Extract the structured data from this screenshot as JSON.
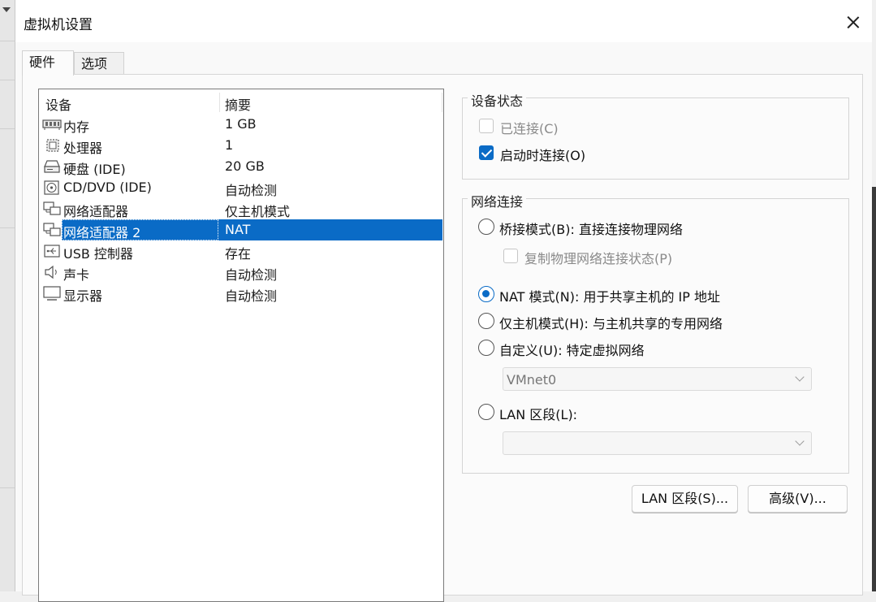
{
  "window": {
    "title": "虚拟机设置"
  },
  "tabs": [
    {
      "label": "硬件",
      "active": true
    },
    {
      "label": "选项",
      "active": false
    }
  ],
  "device_list": {
    "columns": [
      "设备",
      "摘要"
    ],
    "rows": [
      {
        "name": "内存",
        "summary": "1 GB",
        "icon": "memory-icon"
      },
      {
        "name": "处理器",
        "summary": "1",
        "icon": "processor-icon"
      },
      {
        "name": "硬盘 (IDE)",
        "summary": "20 GB",
        "icon": "hard-disk-icon"
      },
      {
        "name": "CD/DVD (IDE)",
        "summary": "自动检测",
        "icon": "cd-dvd-icon"
      },
      {
        "name": "网络适配器",
        "summary": "仅主机模式",
        "icon": "network-adapter-icon"
      },
      {
        "name": "网络适配器 2",
        "summary": "NAT",
        "icon": "network-adapter-icon",
        "selected": true
      },
      {
        "name": "USB 控制器",
        "summary": "存在",
        "icon": "usb-icon"
      },
      {
        "name": "声卡",
        "summary": "自动检测",
        "icon": "speaker-icon"
      },
      {
        "name": "显示器",
        "summary": "自动检测",
        "icon": "monitor-icon"
      }
    ]
  },
  "device_status": {
    "title": "设备状态",
    "connected": {
      "label": "已连接(C)",
      "checked": false,
      "enabled": false
    },
    "connect_at_power_on": {
      "label": "启动时连接(O)",
      "checked": true,
      "enabled": true
    }
  },
  "network_connection": {
    "title": "网络连接",
    "bridged": {
      "label": "桥接模式(B): 直接连接物理网络",
      "checked": false
    },
    "replicate": {
      "label": "复制物理网络连接状态(P)",
      "checked": false,
      "enabled": false
    },
    "nat": {
      "label": "NAT 模式(N): 用于共享主机的 IP 地址",
      "checked": true
    },
    "host_only": {
      "label": "仅主机模式(H): 与主机共享的专用网络",
      "checked": false
    },
    "custom": {
      "label": "自定义(U): 特定虚拟网络",
      "checked": false
    },
    "custom_network": {
      "value": "VMnet0"
    },
    "lan_segment": {
      "label": "LAN 区段(L):",
      "checked": false
    },
    "lan_segment_value": {
      "value": ""
    }
  },
  "buttons": {
    "lan_segments": "LAN 区段(S)...",
    "advanced": "高级(V)..."
  },
  "colors": {
    "accent": "#0a6bc6",
    "selection": "#0a6bc6"
  }
}
